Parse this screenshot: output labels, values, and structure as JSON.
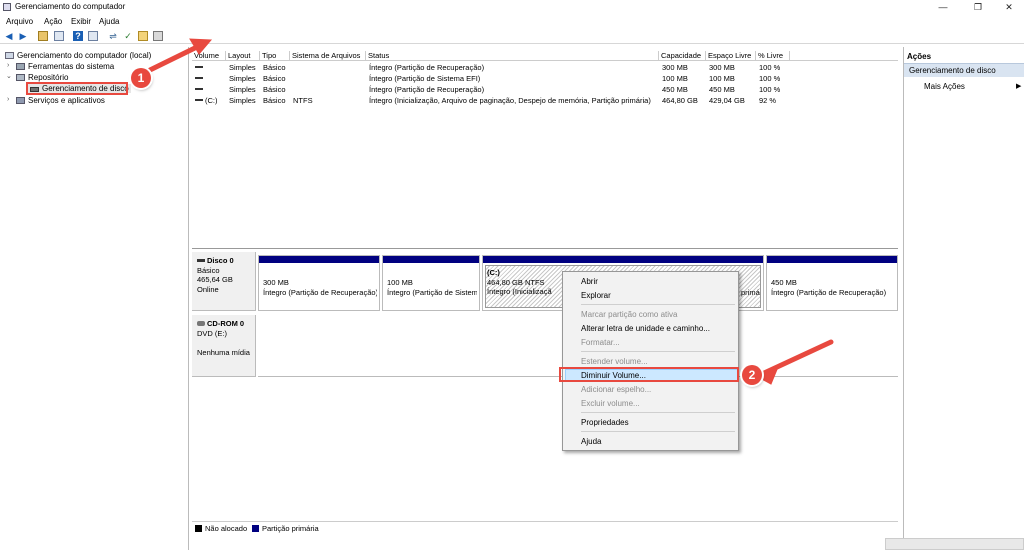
{
  "window": {
    "title": "Gerenciamento do computador",
    "controls": [
      "—",
      "❐",
      "✕"
    ]
  },
  "menu": [
    "Arquivo",
    "Ação",
    "Exibir",
    "Ajuda"
  ],
  "toolbar": [
    "back-icon",
    "forward-icon",
    "up-folder-icon",
    "properties-icon",
    "help-icon",
    "console-icon",
    "connect-icon",
    "check-icon",
    "folder-icon",
    "disk-icon"
  ],
  "tree": {
    "root": "Gerenciamento do computador (local)",
    "items": [
      {
        "label": "Ferramentas do sistema",
        "toggle": "›"
      },
      {
        "label": "Repositório",
        "toggle": "⌄"
      },
      {
        "label": "Gerenciamento de disco",
        "toggle": ""
      },
      {
        "label": "Serviços e aplicativos",
        "toggle": "›"
      }
    ]
  },
  "volume_table": {
    "headers": [
      "Volume",
      "Layout",
      "Tipo",
      "Sistema de Arquivos",
      "Status",
      "Capacidade",
      "Espaço Livre",
      "% Livre"
    ],
    "rows": [
      [
        "",
        "Simples",
        "Básico",
        "",
        "Íntegro (Partição de Recuperação)",
        "300 MB",
        "300 MB",
        "100 %"
      ],
      [
        "",
        "Simples",
        "Básico",
        "",
        "Íntegro (Partição de Sistema EFI)",
        "100 MB",
        "100 MB",
        "100 %"
      ],
      [
        "",
        "Simples",
        "Básico",
        "",
        "Íntegro (Partição de Recuperação)",
        "450 MB",
        "450 MB",
        "100 %"
      ],
      [
        "(C:)",
        "Simples",
        "Básico",
        "NTFS",
        "Íntegro (Inicialização, Arquivo de paginação, Despejo de memória, Partição primária)",
        "464,80 GB",
        "429,04 GB",
        "92 %"
      ]
    ]
  },
  "disks": [
    {
      "name": "Disco 0",
      "lines": [
        "Básico",
        "465,64 GB",
        "Online"
      ],
      "partitions": [
        {
          "title": "",
          "size": "300 MB",
          "status": "Íntegro (Partição de Recuperação)"
        },
        {
          "title": "",
          "size": "100 MB",
          "status": "Íntegro (Partição de Sistem"
        },
        {
          "title": "(C:)",
          "size": "464,80 GB NTFS",
          "status": "Íntegro (Inicializaçã"
        },
        {
          "title": "",
          "size": "450 MB",
          "status": "Íntegro (Partição de Recuperação)"
        }
      ],
      "partial_text": "primá"
    },
    {
      "name": "CD-ROM 0",
      "lines": [
        "DVD (E:)",
        "",
        "Nenhuma mídia"
      ]
    }
  ],
  "legend": [
    {
      "label": "Não alocado",
      "color": "#000000"
    },
    {
      "label": "Partição primária",
      "color": "#000080"
    }
  ],
  "actions": {
    "title": "Ações",
    "section": "Gerenciamento de disco",
    "item": "Mais Ações"
  },
  "context_menu": {
    "items": [
      {
        "label": "Abrir",
        "disabled": false
      },
      {
        "label": "Explorar",
        "disabled": false
      },
      {
        "label": "Marcar partição como ativa",
        "disabled": true
      },
      {
        "label": "Alterar letra de unidade e caminho...",
        "disabled": false
      },
      {
        "label": "Formatar...",
        "disabled": true
      },
      {
        "label": "Estender volume...",
        "disabled": true
      },
      {
        "label": "Diminuir Volume...",
        "disabled": false,
        "highlighted": true
      },
      {
        "label": "Adicionar espelho...",
        "disabled": true
      },
      {
        "label": "Excluir volume...",
        "disabled": true
      },
      {
        "label": "Propriedades",
        "disabled": false
      },
      {
        "label": "Ajuda",
        "disabled": false
      }
    ]
  },
  "annotations": {
    "badge1": "1",
    "badge2": "2",
    "color": "#e8493f"
  }
}
